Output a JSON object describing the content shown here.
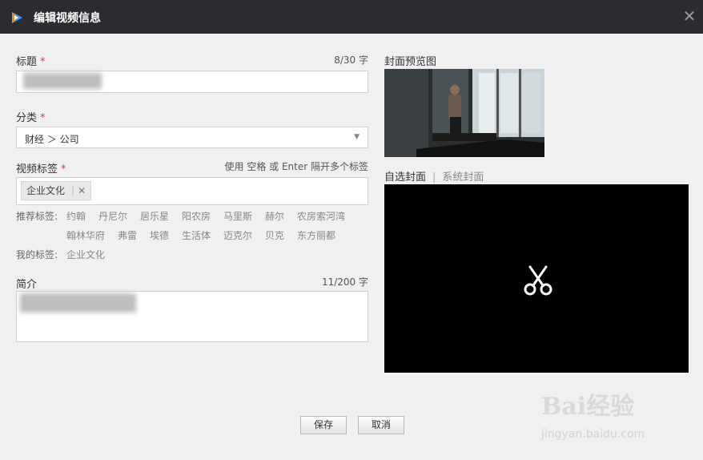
{
  "window": {
    "title": "编辑视频信息"
  },
  "form": {
    "title_label": "标题",
    "required_mark": "*",
    "title_count": "8/30 字",
    "category_label": "分类",
    "category_value": "财经 ＞ 公司",
    "tags_label": "视频标签",
    "tags_hint": "使用 空格 或 Enter 隔开多个标签",
    "selected_tags": [
      {
        "label": "企业文化",
        "remove": "✕"
      }
    ],
    "recommended_label": "推荐标签:",
    "recommended_tags": [
      "约翰",
      "丹尼尔",
      "居乐星",
      "阳农房",
      "马里斯",
      "赫尔",
      "农房索河湾",
      "翰林华府",
      "弗雷",
      "埃德",
      "生活体",
      "迈克尔",
      "贝克",
      "东方丽都"
    ],
    "my_tags_label": "我的标签:",
    "my_tags": [
      "企业文化"
    ],
    "intro_label": "简介",
    "intro_count": "11/200 字"
  },
  "preview": {
    "label": "封面预览图",
    "tab_custom": "自选封面",
    "tab_separator": "|",
    "tab_system": "系统封面"
  },
  "buttons": {
    "save": "保存",
    "cancel": "取消"
  },
  "icons": {
    "close": "close-icon",
    "scissors": "scissors-icon",
    "dropdown": "dropdown-arrow-icon",
    "logo": "app-logo-icon"
  },
  "watermark": {
    "text": "Bai经验",
    "url": "jingyan.baidu.com"
  },
  "colors": {
    "titlebar": "#2b2c30",
    "required": "#e8333a",
    "panel_bg": "#f0f0f0",
    "cover_bg": "#000000"
  }
}
